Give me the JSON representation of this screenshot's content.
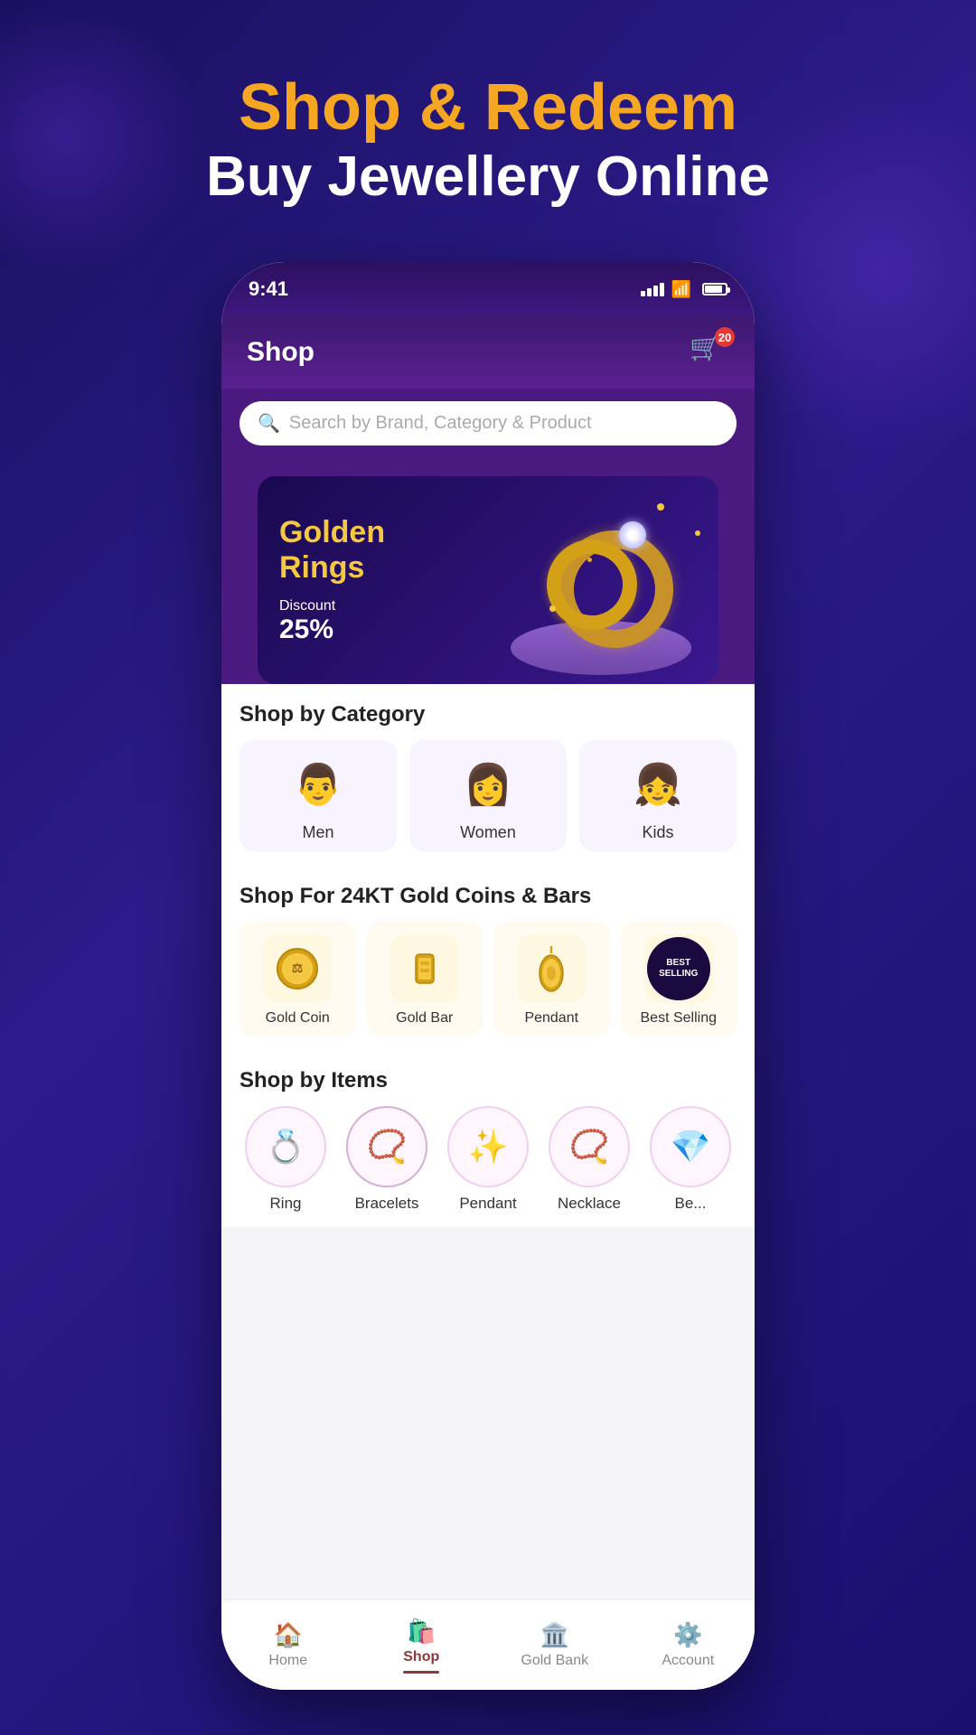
{
  "hero": {
    "title_gold": "Shop & Redeem",
    "title_white": "Buy Jewellery Online"
  },
  "status_bar": {
    "time": "9:41"
  },
  "header": {
    "title": "Shop",
    "cart_count": "20"
  },
  "search": {
    "placeholder": "Search by Brand, Category & Product"
  },
  "banner": {
    "title_line1": "Golden",
    "title_line2": "Rings",
    "discount_label": "Discount",
    "discount_value": "25%"
  },
  "shop_by_category": {
    "section_title": "Shop by Category",
    "items": [
      {
        "label": "Men",
        "icon": "👨"
      },
      {
        "label": "Women",
        "icon": "👩"
      },
      {
        "label": "Kids",
        "icon": "👧"
      }
    ]
  },
  "gold_coins_bars": {
    "section_title": "Shop For 24KT Gold Coins & Bars",
    "items": [
      {
        "label": "Gold Coin",
        "icon": "🪙"
      },
      {
        "label": "Gold Bar",
        "icon": "🥇"
      },
      {
        "label": "Pendant",
        "icon": "📿"
      },
      {
        "label": "Best Selling",
        "icon": "★"
      }
    ]
  },
  "shop_by_items": {
    "section_title": "Shop by Items",
    "items": [
      {
        "label": "Ring",
        "icon": "💍"
      },
      {
        "label": "Bracelets",
        "icon": "📿"
      },
      {
        "label": "Pendant",
        "icon": "✨"
      },
      {
        "label": "Necklace",
        "icon": "📿"
      },
      {
        "label": "Be...",
        "icon": "💎"
      }
    ]
  },
  "bottom_nav": {
    "items": [
      {
        "label": "Home",
        "icon": "🏠",
        "active": false
      },
      {
        "label": "Shop",
        "icon": "🛍️",
        "active": true
      },
      {
        "label": "Gold Bank",
        "icon": "🏛️",
        "active": false
      },
      {
        "label": "Account",
        "icon": "⚙️",
        "active": false
      }
    ]
  }
}
